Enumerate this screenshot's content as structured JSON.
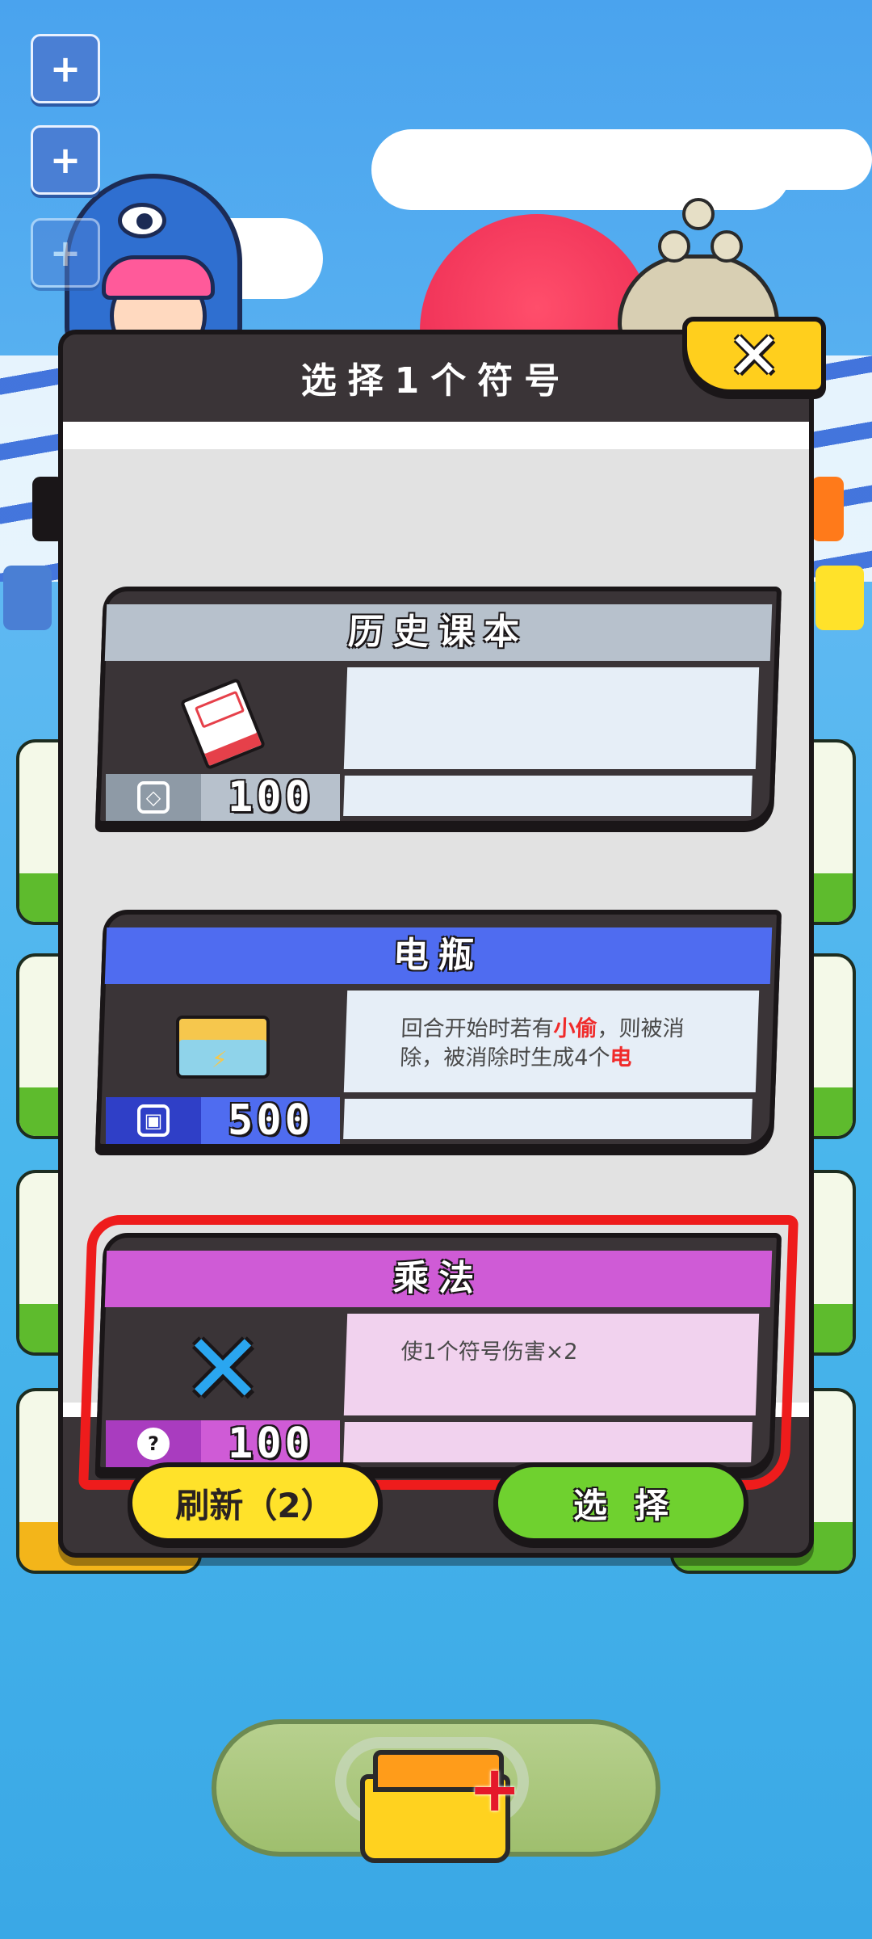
{
  "modal": {
    "title": "选择1个符号",
    "close_icon": "close-icon",
    "refresh_label": "刷新（2）",
    "select_label": "选择"
  },
  "cards": [
    {
      "name": "历史课本",
      "icon": "history-book-icon",
      "cost_icon": "eraser-icon",
      "cost": "100",
      "description_parts": [],
      "color": "#b7c1cc",
      "selected": false
    },
    {
      "name": "电瓶",
      "icon": "battery-box-icon",
      "cost_icon": "chip-icon",
      "cost": "500",
      "description_parts": [
        "回合开始时若有",
        "小偷",
        "，则被消除，被消除时生成4个",
        "电"
      ],
      "color": "#4f6cf0",
      "selected": false
    },
    {
      "name": "乘法",
      "icon": "multiply-icon",
      "cost_icon": "question-icon",
      "cost": "100",
      "description_parts": [
        "使1个符号伤害×2"
      ],
      "color": "#cf5bd6",
      "selected": true
    }
  ],
  "side_buttons": [
    "plus-icon",
    "plus-icon",
    "plus-icon"
  ],
  "deck_button": {
    "icon": "folder-add-icon"
  },
  "colors": {
    "accent_select": "#6fd12f",
    "accent_refresh": "#ffe22a",
    "highlight_text": "#f02b2b",
    "selection_border": "#ee1c1c"
  }
}
